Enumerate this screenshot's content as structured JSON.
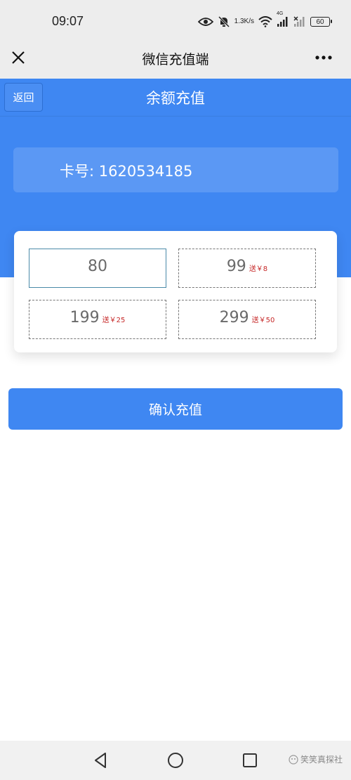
{
  "status_bar": {
    "time": "09:07",
    "net_speed_value": "1.3",
    "net_speed_unit": "K/s",
    "network_label": "4G",
    "battery": "60",
    "icons": [
      "eye-icon",
      "mute-bell-icon",
      "wifi-icon",
      "signal-icon",
      "signal-weak-icon",
      "battery-icon"
    ]
  },
  "title_bar": {
    "title": "微信充值端",
    "close_icon": "close-icon",
    "more_icon": "more-dots-icon"
  },
  "header": {
    "back_label": "返回",
    "title": "余额充值"
  },
  "card": {
    "label": "卡号: 1620534185"
  },
  "amounts": [
    {
      "value": "80",
      "bonus": "",
      "selected": true
    },
    {
      "value": "99",
      "bonus": "送￥8",
      "selected": false
    },
    {
      "value": "199",
      "bonus": "送￥25",
      "selected": false
    },
    {
      "value": "299",
      "bonus": "送￥50",
      "selected": false
    }
  ],
  "confirm": {
    "label": "确认充值"
  },
  "nav": {
    "icons": [
      "back-triangle-icon",
      "home-circle-icon",
      "recents-square-icon"
    ],
    "watermark": "笑笑真探社"
  },
  "colors": {
    "primary": "#3f87f2",
    "bonus": "#c62828",
    "system_bar": "#ededed"
  }
}
